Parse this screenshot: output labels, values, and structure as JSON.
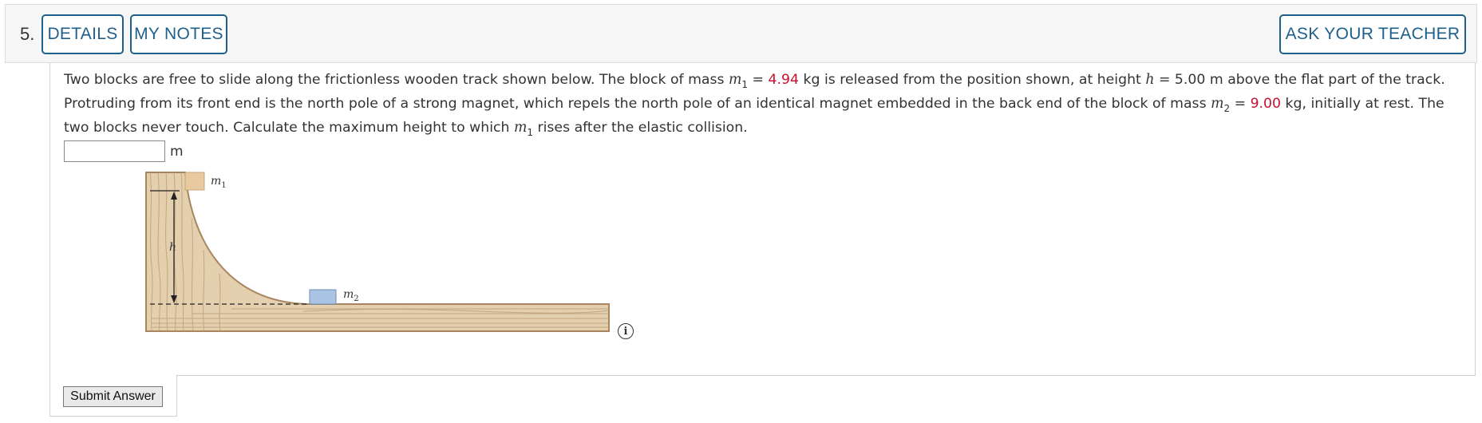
{
  "question": {
    "number": "5.",
    "tabs": {
      "details": "DETAILS",
      "my_notes": "MY NOTES"
    },
    "ask_teacher": "ASK YOUR TEACHER",
    "text": {
      "p1": "Two blocks are free to slide along the frictionless wooden track shown below. The block of mass ",
      "m1_var": "m",
      "m1_sub": "1",
      "p2": " = ",
      "m1_value": "4.94",
      "p3": " kg is released from the position shown, at height ",
      "h_var": "h",
      "p4": " = 5.00 m above the flat part of the track. Protruding from its front end is the north pole of a strong magnet, which repels the north pole of an identical magnet embedded in the back end of the block of mass ",
      "m2_var": "m",
      "m2_sub": "2",
      "p5": " = ",
      "m2_value": "9.00",
      "p6": " kg, initially at rest. The two blocks never touch. Calculate the maximum height to which ",
      "m1b_var": "m",
      "m1b_sub": "1",
      "p7": " rises after the elastic collision."
    },
    "answer": {
      "value": "",
      "unit": "m"
    },
    "figure": {
      "m1_label": "m",
      "m1_sub": "1",
      "m2_label": "m",
      "m2_sub": "2",
      "h_label": "h"
    },
    "info_icon": "info-icon",
    "submit_label": "Submit Answer"
  },
  "colors": {
    "link_blue": "#1f5f8b",
    "value_red": "#c8102e",
    "wood": "#e4cfae",
    "wood_grain": "#b89a72",
    "block_m1": "#e8c9a0",
    "block_m2": "#a9c4e4"
  }
}
